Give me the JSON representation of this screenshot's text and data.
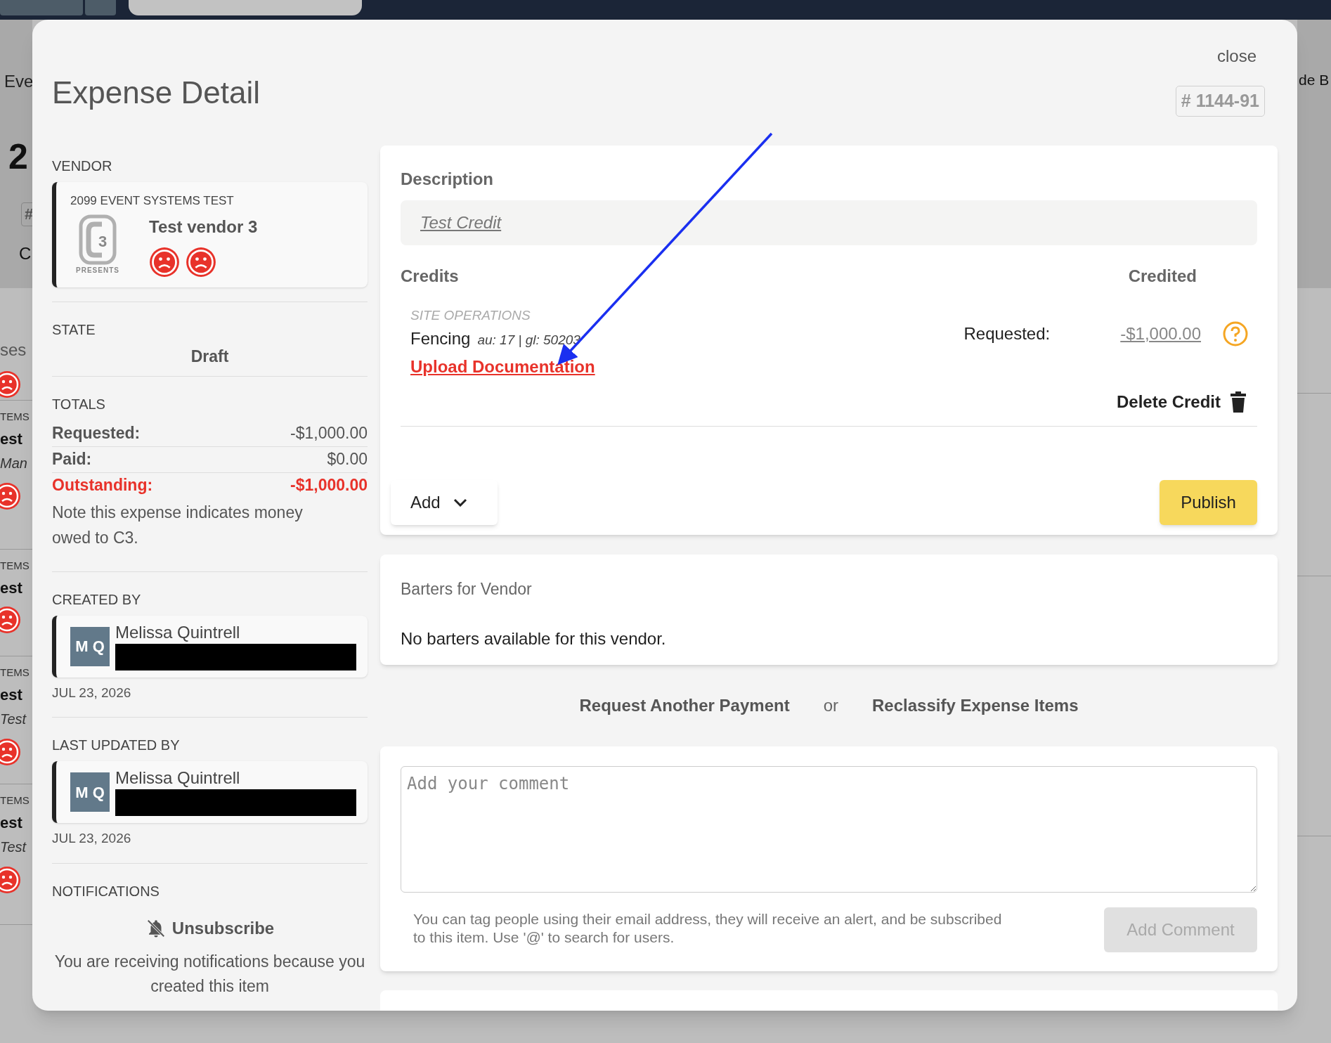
{
  "background_page": {
    "header_fragment": "Eve",
    "right_fragment": "de B",
    "big_fragment": "2",
    "badge_fragment": "#",
    "line_fragment": "C",
    "section_fragment": "ses",
    "rows": [
      {
        "category": "TEMS",
        "title": "est",
        "subtitle": "Man"
      },
      {
        "category": "TEMS",
        "title": "est"
      },
      {
        "category": "TEMS",
        "title": "est",
        "subtitle": "Test"
      },
      {
        "category": "TEMS",
        "title": "est",
        "subtitle": "Test"
      }
    ]
  },
  "modal": {
    "close": "close",
    "title": "Expense Detail",
    "number": "# 1144-91",
    "vendor": {
      "label": "VENDOR",
      "event": "2099 EVENT SYSTEMS TEST",
      "logo": {
        "mark": "3",
        "caption": "PRESENTS"
      },
      "name": "Test vendor 3",
      "faces": [
        {
          "kind": "sad"
        },
        {
          "kind": "sad"
        }
      ]
    },
    "state": {
      "label": "STATE",
      "value": "Draft"
    },
    "totals": {
      "label": "TOTALS",
      "rows": [
        {
          "label": "Requested:",
          "value": "-$1,000.00",
          "highlight": false
        },
        {
          "label": "Paid:",
          "value": "$0.00",
          "highlight": false
        },
        {
          "label": "Outstanding:",
          "value": "-$1,000.00",
          "highlight": true
        }
      ],
      "note": "Note this expense indicates money owed to C3."
    },
    "created_by": {
      "label": "CREATED BY",
      "initials": "M Q",
      "name": "Melissa Quintrell",
      "redacted": true,
      "date": "JUL 23, 2026"
    },
    "last_updated_by": {
      "label": "LAST UPDATED BY",
      "initials": "M Q",
      "name": "Melissa Quintrell",
      "redacted": true,
      "date": "JUL 23, 2026"
    },
    "notifications": {
      "label": "NOTIFICATIONS",
      "action": "Unsubscribe",
      "note": "You are receiving notifications because you created this item"
    },
    "description": {
      "label": "Description",
      "value": "Test Credit"
    },
    "credits": {
      "label": "Credits",
      "column": "Credited",
      "items": [
        {
          "category": "SITE OPERATIONS",
          "name": "Fencing",
          "codes": "au: 17 | gl: 50203",
          "upload": "Upload Documentation",
          "requested_label": "Requested:",
          "amount": "-$1,000.00",
          "delete": "Delete Credit"
        }
      ]
    },
    "add_button": "Add",
    "publish_button": "Publish",
    "barters": {
      "title": "Barters for Vendor",
      "message": "No barters available for this vendor."
    },
    "links": [
      "Request Another Payment",
      "or",
      "Reclassify Expense Items"
    ],
    "comment": {
      "placeholder": "Add your comment",
      "hint": "You can tag people using their email address, they will receive an alert, and be subscribed to this item. Use '@' to search for users.",
      "button": "Add Comment",
      "disabled": true
    }
  },
  "annotations": [
    {
      "kind": "arrow"
    }
  ]
}
